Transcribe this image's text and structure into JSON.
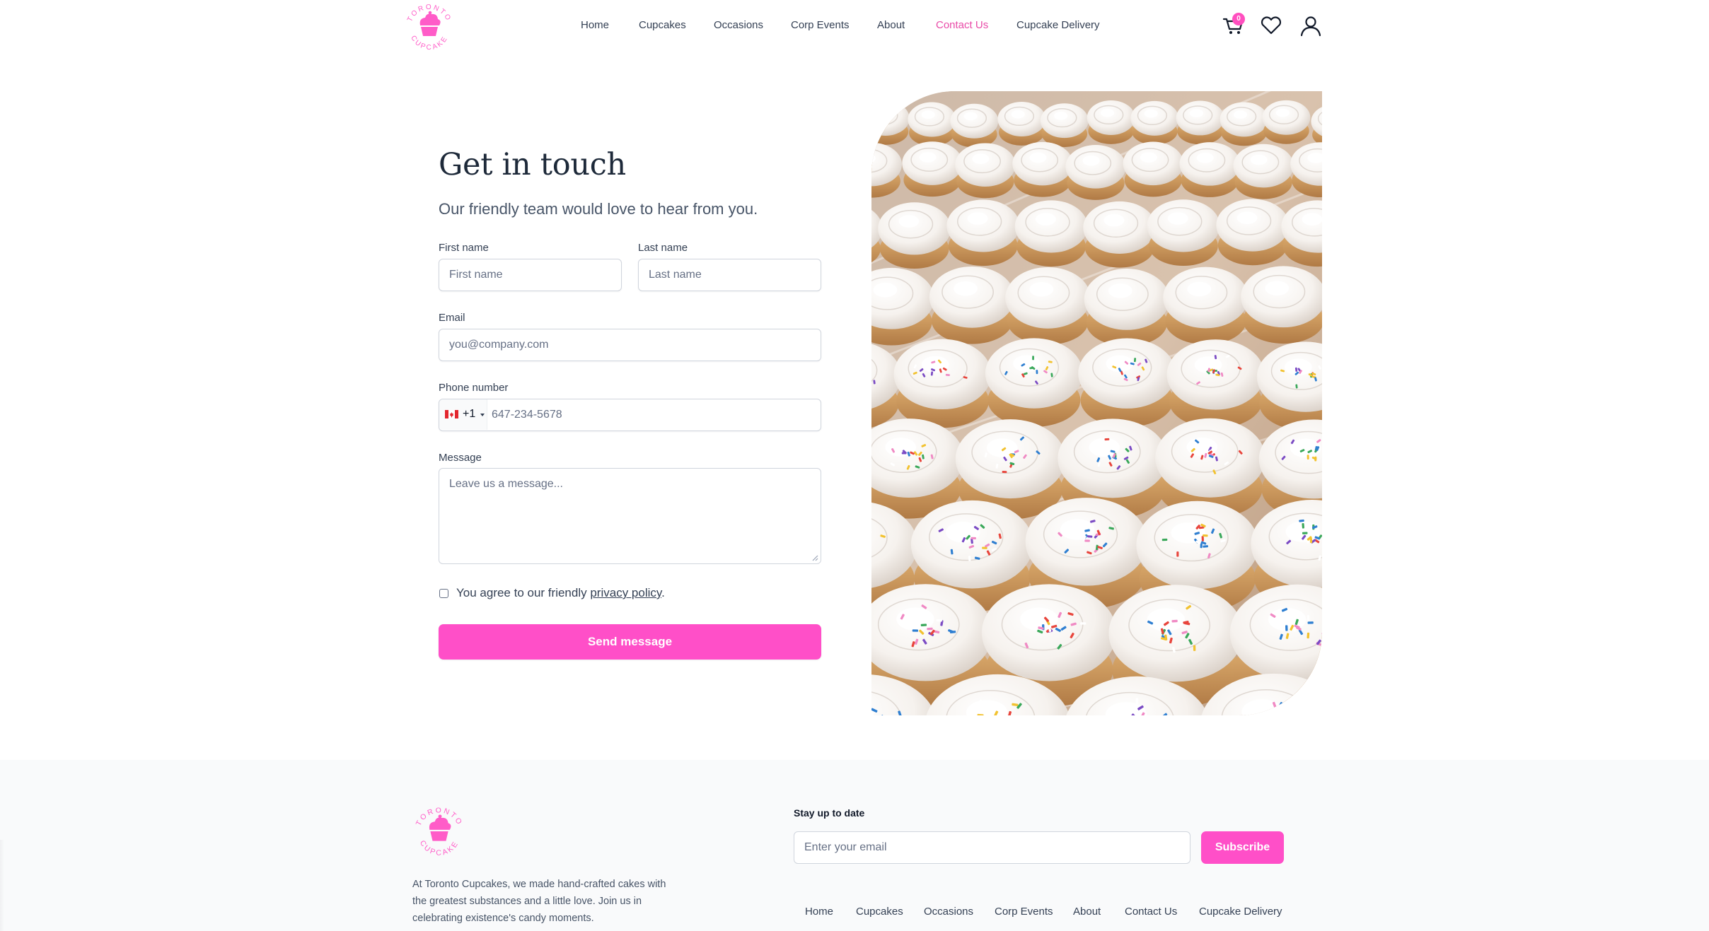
{
  "brand": {
    "logo_top": "TORONTO",
    "logo_bottom": "CUPCAKE",
    "accent": "#ff4fc8",
    "active_link": "#e94ba8"
  },
  "nav": {
    "items": [
      {
        "label": "Home",
        "active": false
      },
      {
        "label": "Cupcakes",
        "active": false
      },
      {
        "label": "Occasions",
        "active": false
      },
      {
        "label": "Corp Events",
        "active": false
      },
      {
        "label": "About",
        "active": false
      },
      {
        "label": "Contact Us",
        "active": true
      },
      {
        "label": "Cupcake Delivery",
        "active": false
      }
    ],
    "cart_count": "0",
    "icons": [
      "cart-icon",
      "heart-icon",
      "user-icon"
    ]
  },
  "contact": {
    "title": "Get in touch",
    "subtitle": "Our friendly team would love to hear from you.",
    "first_name": {
      "label": "First name",
      "placeholder": "First name"
    },
    "last_name": {
      "label": "Last name",
      "placeholder": "Last name"
    },
    "email": {
      "label": "Email",
      "placeholder": "you@company.com"
    },
    "phone": {
      "label": "Phone number",
      "country_code": "+1",
      "placeholder": "647-234-5678",
      "flag": "canada-flag-icon"
    },
    "message": {
      "label": "Message",
      "placeholder": "Leave us a message..."
    },
    "agree_prefix": "You agree to our friendly ",
    "agree_link": "privacy policy",
    "agree_suffix": ".",
    "submit_label": "Send message"
  },
  "footer": {
    "description": "At Toronto Cupcakes, we made hand-crafted cakes with the greatest substances and a little love. Join us in celebrating existence's candy moments.",
    "newsletter_title": "Stay up to date",
    "email_placeholder": "Enter your email",
    "subscribe_label": "Subscribe",
    "links": [
      "Home",
      "Cupcakes",
      "Occasions",
      "Corp Events",
      "About",
      "Contact Us",
      "Cupcake Delivery"
    ]
  }
}
